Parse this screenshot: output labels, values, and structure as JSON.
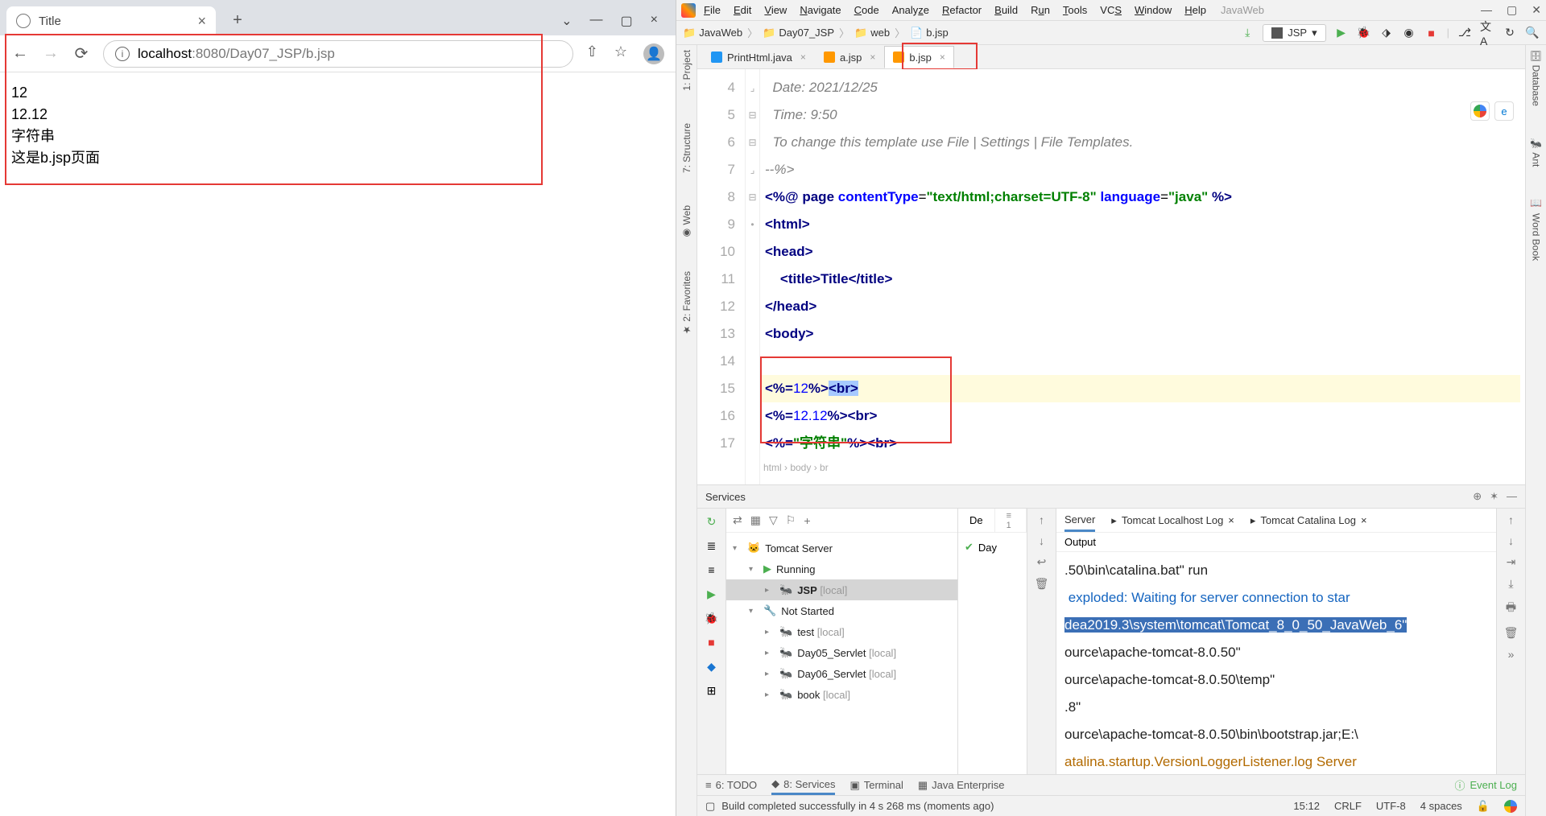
{
  "chrome": {
    "tab_title": "Title",
    "url_host": "localhost",
    "url_port": ":8080",
    "url_path": "/Day07_JSP/b.jsp",
    "page_lines": [
      "12",
      "12.12",
      "字符串",
      "这是b.jsp页面"
    ]
  },
  "idea": {
    "product": "JavaWeb",
    "menus": [
      "File",
      "Edit",
      "View",
      "Navigate",
      "Code",
      "Analyze",
      "Refactor",
      "Build",
      "Run",
      "Tools",
      "VCS",
      "Window",
      "Help"
    ],
    "breadcrumb": [
      "JavaWeb",
      "Day07_JSP",
      "web",
      "b.jsp"
    ],
    "run_config": "JSP",
    "editor_tabs": [
      {
        "label": "PrintHtml.java",
        "active": false,
        "kind": "java"
      },
      {
        "label": "a.jsp",
        "active": false,
        "kind": "jsp"
      },
      {
        "label": "b.jsp",
        "active": true,
        "kind": "jsp"
      }
    ],
    "line_numbers": [
      "4",
      "5",
      "6",
      "7",
      "8",
      "9",
      "10",
      "11",
      "12",
      "13",
      "14",
      "15",
      "16",
      "17"
    ],
    "code": {
      "l4": "  Date: 2021/12/25",
      "l5": "  Time: 9:50",
      "l6": "  To change this template use File | Settings | File Templates.",
      "l7": "--%>",
      "l8_pre": "<%@ ",
      "l8_kw1": "page ",
      "l8_attr1": "contentType",
      "l8_eq1": "=",
      "l8_str1": "\"text/html;charset=UTF-8\"",
      "l8_sp": " ",
      "l8_attr2": "language",
      "l8_eq2": "=",
      "l8_str2": "\"java\"",
      "l8_end": " %>",
      "l9": "<html>",
      "l10": "<head>",
      "l11": "    <title>Title</title>",
      "l12": "</head>",
      "l13": "<body>",
      "l14": "",
      "l15_a": "<%=",
      "l15_b": "12",
      "l15_c": "%>",
      "l15_d": "<br>",
      "l16_a": "<%=",
      "l16_b": "12.12",
      "l16_c": "%>",
      "l16_d": "<br>",
      "l17_a": "<%=",
      "l17_b": "\"字符串\"",
      "l17_c": "%>",
      "l17_d": "<br>",
      "crumb_path": "html › body › br"
    },
    "services": {
      "title": "Services",
      "tree": {
        "root": "Tomcat Server",
        "running": "Running",
        "jsp": "JSP",
        "jsp_suffix": "[local]",
        "not_started": "Not Started",
        "items": [
          {
            "n": "test",
            "s": "[local]"
          },
          {
            "n": "Day05_Servlet",
            "s": "[local]"
          },
          {
            "n": "Day06_Servlet",
            "s": "[local]"
          },
          {
            "n": "book",
            "s": "[local]"
          }
        ]
      },
      "mid_tab": "De",
      "mid_badge": "≡ 1",
      "mid_row": "Day",
      "console_tabs": [
        "Server",
        "Tomcat Localhost Log",
        "Tomcat Catalina Log"
      ],
      "output_label": "Output",
      "output_lines": [
        ".50\\bin\\catalina.bat\" run",
        " exploded: Waiting for server connection to star",
        "dea2019.3\\system\\tomcat\\Tomcat_8_0_50_JavaWeb_6\"",
        "ource\\apache-tomcat-8.0.50\"",
        "ource\\apache-tomcat-8.0.50\\temp\"",
        ".8\"",
        "ource\\apache-tomcat-8.0.50\\bin\\bootstrap.jar;E:\\",
        "atalina.startup.VersionLoggerListener.log Server"
      ]
    },
    "bottom_tabs": {
      "todo": "6: TODO",
      "services": "8: Services",
      "terminal": "Terminal",
      "je": "Java Enterprise",
      "event_log": "Event Log"
    },
    "status": {
      "msg": "Build completed successfully in 4 s 268 ms (moments ago)",
      "pos": "15:12",
      "eol": "CRLF",
      "enc": "UTF-8",
      "indent": "4 spaces"
    }
  }
}
